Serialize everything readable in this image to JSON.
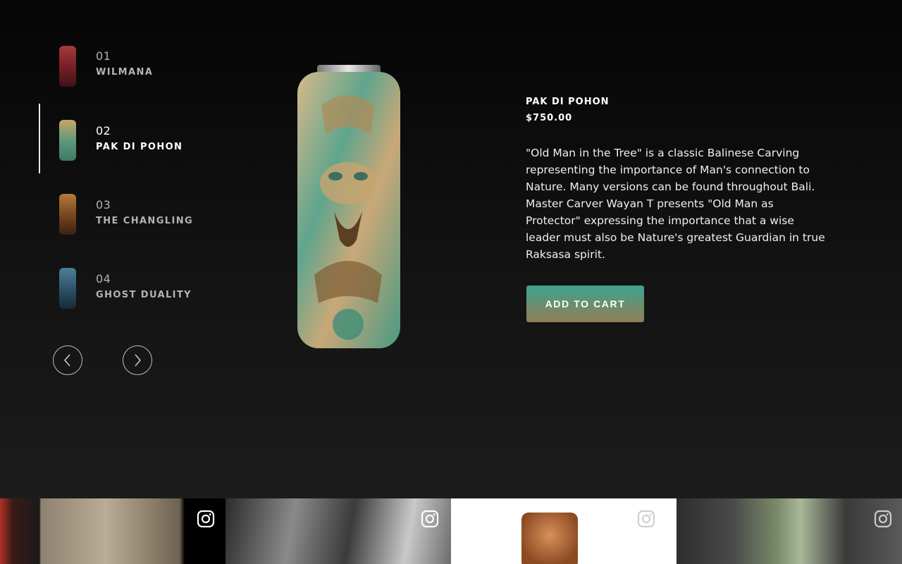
{
  "products": [
    {
      "number": "01",
      "name": "WILMANA",
      "active": false
    },
    {
      "number": "02",
      "name": "PAK DI POHON",
      "active": true
    },
    {
      "number": "03",
      "name": "THE CHANGLING",
      "active": false
    },
    {
      "number": "04",
      "name": "GHOST DUALITY",
      "active": false
    }
  ],
  "navigation": {
    "prev_icon": "chevron-left-icon",
    "next_icon": "chevron-right-icon"
  },
  "selected": {
    "title": "PAK DI POHON",
    "price": "$750.00",
    "description": "\"Old Man in the Tree\" is a classic Balinese Carving representing the importance of Man's connection to Nature. Many versions can be found throughout Bali. Master Carver Wayan T presents \"Old Man as Protector\" expressing the importance that a wise leader must also be Nature's greatest Guardian in true Raksasa spirit.",
    "cta": "ADD TO CART"
  },
  "instagram": {
    "icon": "instagram-icon",
    "tiles": 4
  },
  "colors": {
    "background": "#111111",
    "accent_teal": "#3aa68e",
    "accent_bronze": "#8f7f58"
  }
}
